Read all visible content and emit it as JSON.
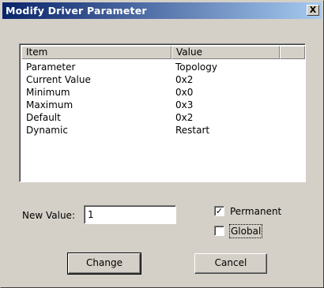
{
  "window": {
    "title": "Modify Driver Parameter",
    "close_glyph": "X"
  },
  "list": {
    "columns": [
      "Item",
      "Value"
    ],
    "rows": [
      {
        "item": "Parameter",
        "value": "Topology"
      },
      {
        "item": "Current Value",
        "value": "0x2"
      },
      {
        "item": "Minimum",
        "value": "0x0"
      },
      {
        "item": "Maximum",
        "value": "0x3"
      },
      {
        "item": "Default",
        "value": "0x2"
      },
      {
        "item": "Dynamic",
        "value": "Restart"
      }
    ]
  },
  "new_value": {
    "label": "New Value:",
    "value": "1"
  },
  "options": {
    "permanent": {
      "label": "Permanent",
      "checked": true,
      "check_glyph": "✓"
    },
    "global": {
      "label": "Global",
      "checked": false
    }
  },
  "buttons": {
    "change": "Change",
    "cancel": "Cancel"
  },
  "colors": {
    "titlebar_start": "#0a246a",
    "titlebar_end": "#a6caf0",
    "dialog_face": "#d4d0c8"
  }
}
